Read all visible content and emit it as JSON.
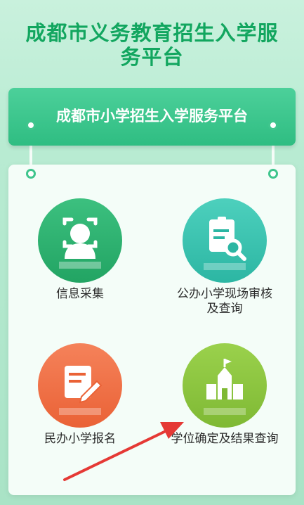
{
  "header": {
    "title": "成都市义务教育招生入学服务平台"
  },
  "banner": {
    "title": "成都市小学招生入学服务平台"
  },
  "menu": [
    {
      "label": "信息采集",
      "icon": "user-scan-icon",
      "color": "#2db373"
    },
    {
      "label": "公办小学现场审核及查询",
      "icon": "document-search-icon",
      "color": "#33c0ad"
    },
    {
      "label": "民办小学报名",
      "icon": "edit-form-icon",
      "color": "#f07148"
    },
    {
      "label": "学位确定及结果查询",
      "icon": "school-building-icon",
      "color": "#8cc63f"
    }
  ],
  "colors": {
    "title": "#12a65f",
    "banner": "#3fc58d",
    "arrow": "#e53935"
  }
}
